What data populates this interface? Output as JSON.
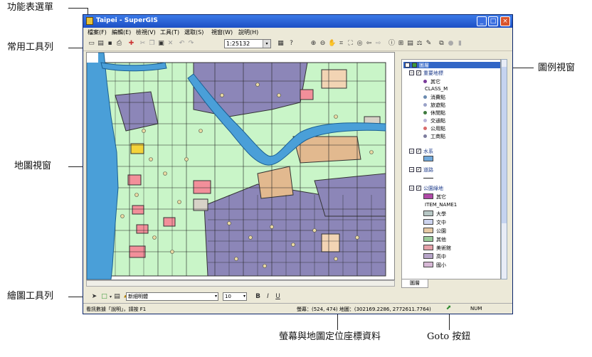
{
  "callouts": {
    "menu": "功能表選單",
    "toolbar": "常用工具列",
    "map": "地圖視窗",
    "legend": "圖例視窗",
    "draw": "繪圖工具列",
    "coords": "螢幕與地圖定位座標資料",
    "goto": "Goto 按鈕"
  },
  "window": {
    "title": "Taipei - SuperGIS",
    "min": "_",
    "max": "□",
    "close": "×"
  },
  "menu": [
    "檔案(F)",
    "編輯(E)",
    "檢視(V)",
    "工具(T)",
    "選取(S)",
    "視窗(W)",
    "說明(H)"
  ],
  "toolbar": {
    "scale": "1:25132",
    "dropdown": "▾"
  },
  "legend": {
    "layers": {
      "root": "圖層",
      "poi": "重要地標",
      "water": "水系",
      "road": "道路",
      "landuse": "公園綠地"
    },
    "poi_items": [
      "其它",
      "CLASS_M",
      "消費點",
      "旅遊點",
      "休閒點",
      "交通點",
      "公用點",
      "工商點"
    ],
    "poi_colors": [
      "#7a3b9a",
      "#ffffff",
      "#6a8bb0",
      "#9aa2c8",
      "#3d7a3d",
      "#b9b4d9",
      "#d96a6a",
      "#7d7d9e"
    ],
    "landuse_items": [
      "其它",
      "ITEM_NAME1",
      "大學",
      "文中",
      "公園",
      "其他",
      "美術館",
      "高中",
      "國小"
    ],
    "landuse_colors": [
      "#b04aa8",
      "#ffffff",
      "#b7c7c5",
      "#ccd3ee",
      "#e6c9a4",
      "#9bcc9b",
      "#e5a1a9",
      "#b7a5c9",
      "#d7b8d6"
    ],
    "water_color": "#6fa8dc",
    "tab": "圖層"
  },
  "drawbar": {
    "font": "新細明體",
    "size": "10",
    "bold": "B",
    "italic": "I",
    "underline": "U"
  },
  "status": {
    "hint": "看訊數據「說明」，請按 F1",
    "coords": "螢幕：(524, 474)  地圖：(302169.2286, 2772611.7764)",
    "num": "NUM"
  },
  "colors": {
    "park": "#c9f5c8",
    "urban": "#8c86b8",
    "river": "#4a9fd8",
    "block": "#f2d4b4",
    "school": "#f28f9a",
    "road": "#222222"
  }
}
